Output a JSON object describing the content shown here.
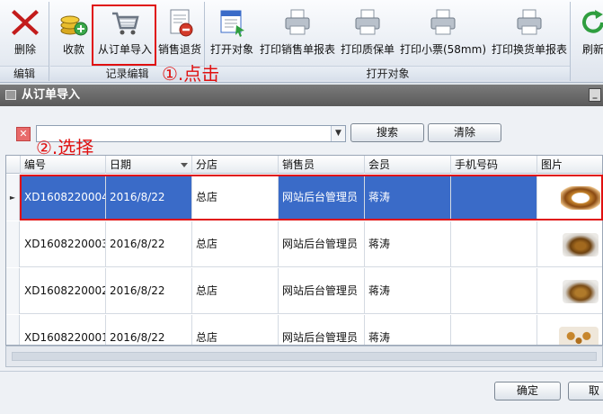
{
  "ribbon": {
    "groups": [
      {
        "label": "编辑",
        "buttons": [
          {
            "label": "删除",
            "icon": "delete-x-icon"
          }
        ]
      },
      {
        "label": "记录编辑",
        "buttons": [
          {
            "label": "收款",
            "icon": "coins-icon"
          },
          {
            "label": "从订单导入",
            "icon": "cart-icon"
          },
          {
            "label": "销售退货",
            "icon": "return-doc-icon"
          }
        ]
      },
      {
        "label": "打开对象",
        "buttons": [
          {
            "label": "打开对象",
            "icon": "open-object-icon"
          },
          {
            "label": "打印销售单报表",
            "icon": "printer-icon"
          },
          {
            "label": "打印质保单",
            "icon": "printer-icon"
          },
          {
            "label": "打印小票(58mm)",
            "icon": "printer-icon"
          },
          {
            "label": "打印换货单报表",
            "icon": "printer-icon"
          }
        ]
      },
      {
        "label": "",
        "buttons": [
          {
            "label": "刷新",
            "icon": "refresh-icon"
          }
        ]
      }
    ]
  },
  "annotations": {
    "step1": "①.点击",
    "step2": "②.选择"
  },
  "dialog": {
    "title": "从订单导入",
    "search_value": "",
    "search_button": "搜索",
    "clear_button": "清除",
    "columns": [
      "编号",
      "日期",
      "分店",
      "销售员",
      "会员",
      "手机号码",
      "图片"
    ],
    "rows": [
      {
        "id": "XD1608220004",
        "date": "2016/8/22",
        "store": "总店",
        "seller": "网站后台管理员",
        "member": "蒋涛",
        "phone": "",
        "image": "bangle-thumbnail"
      },
      {
        "id": "XD1608220003",
        "date": "2016/8/22",
        "store": "总店",
        "seller": "网站后台管理员",
        "member": "蒋涛",
        "phone": "",
        "image": "pendant-thumbnail"
      },
      {
        "id": "XD1608220002",
        "date": "2016/8/22",
        "store": "总店",
        "seller": "网站后台管理员",
        "member": "蒋涛",
        "phone": "",
        "image": "pendant-thumbnail"
      },
      {
        "id": "XD1608220001",
        "date": "2016/8/22",
        "store": "总店",
        "seller": "网站后台管理员",
        "member": "蒋涛",
        "phone": "",
        "image": "beads-thumbnail"
      }
    ],
    "ok_button": "确定",
    "cancel_button": "取"
  },
  "colors": {
    "selection": "#3a6bc8",
    "annotation": "#e01010"
  }
}
